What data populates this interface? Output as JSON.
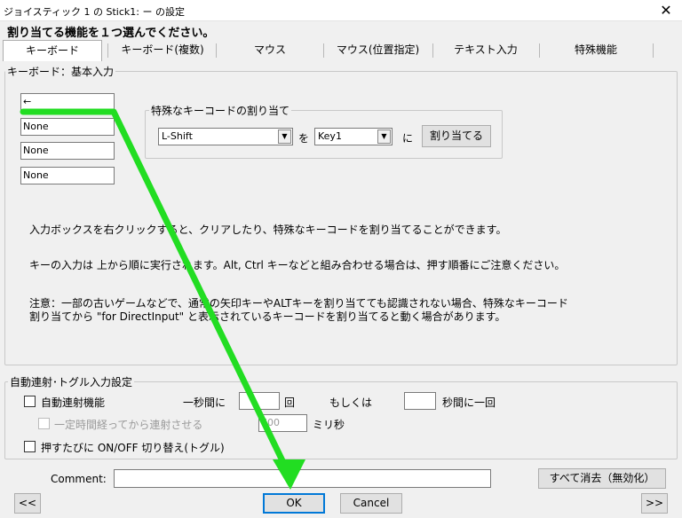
{
  "window": {
    "title": "ジョイスティック 1 の Stick1: ー の設定",
    "close_glyph": "✕"
  },
  "instruction": "割り当てる機能を１つ選んでください。",
  "tabs": [
    {
      "label": "キーボード",
      "active": true
    },
    {
      "label": "キーボード(複数)"
    },
    {
      "label": "マウス"
    },
    {
      "label": "マウス(位置指定)"
    },
    {
      "label": "テキスト入力"
    },
    {
      "label": "特殊機能"
    }
  ],
  "keyboard_group": {
    "title": "キーボード：基本入力",
    "inputs": [
      "←",
      "None",
      "None",
      "None"
    ]
  },
  "special_key_group": {
    "title": "特殊なキーコードの割り当て",
    "select1": "L-Shift",
    "wo_label": "を",
    "select2": "Key1",
    "ni_label": "に",
    "assign_button": "割り当てる"
  },
  "help": {
    "line1": "入力ボックスを右クリックすると、クリアしたり、特殊なキーコードを割り当てることができます。",
    "line2": "キーの入力は 上から順に実行されます。Alt, Ctrl キーなどと組み合わせる場合は、押す順番にご注意ください。",
    "line3a": "注意：一部の古いゲームなどで、通常の矢印キーやALTキーを割り当てても認識されない場合、特殊なキーコード",
    "line3b": "割り当てから \"for DirectInput\" と表示されているキーコードを割り当てると動く場合があります。"
  },
  "auto_group": {
    "title": "自動連射･トグル入力設定",
    "auto_fire_label": "自動連射機能",
    "per_second_label": "一秒間に",
    "per_second_value": "",
    "count_unit": "回",
    "or_label": "もしくは",
    "seconds_value": "",
    "seconds_unit": "秒間に一回",
    "delay_label": "一定時間経ってから連射させる",
    "delay_value": "700",
    "ms_unit": "ミリ秒",
    "toggle_label": "押すたびに ON/OFF 切り替え(トグル)"
  },
  "comment": {
    "label": "Comment:",
    "value": ""
  },
  "buttons": {
    "clear_all": "すべて消去（無効化）",
    "prev": "<<",
    "ok": "OK",
    "cancel": "Cancel",
    "next": ">>"
  },
  "colors": {
    "annotation_arrow": "#22dd22",
    "focus_border": "#0078d7"
  }
}
